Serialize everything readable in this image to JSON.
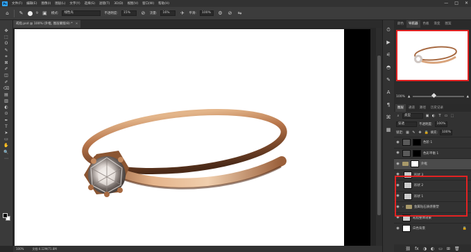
{
  "menubar": {
    "items": [
      "文件(F)",
      "编辑(E)",
      "图像(I)",
      "图层(L)",
      "文字(Y)",
      "选择(S)",
      "滤镜(T)",
      "3D(D)",
      "视图(V)",
      "窗口(W)",
      "帮助(H)"
    ],
    "window_controls": [
      "—",
      "□",
      "✕"
    ]
  },
  "optbar": {
    "brush_size": "9",
    "mode_label": "模式:",
    "mode_value": "线性光",
    "opacity_label": "不透明度:",
    "opacity_value": "15%",
    "flow_label": "流量:",
    "flow_value": "16%",
    "smooth_label": "平滑:",
    "smooth_value": "100%"
  },
  "tab": {
    "title": "戒指.psd @ 100% (外框, 图层蒙版/8) *",
    "close": "×"
  },
  "toolbar": {
    "tools": [
      "✥",
      "⬚",
      "ʘ",
      "✎",
      "⌗",
      "⊠",
      "✐",
      "◫",
      "✐",
      "⌫",
      "▤",
      "▥",
      "◐",
      "⊙",
      "✒",
      "T",
      "➤",
      "▭",
      "✋",
      "🔍",
      "⋯"
    ]
  },
  "statusbar": {
    "zoom": "100%",
    "doc": "文档:4.12M/71.8M"
  },
  "panels": {
    "tabs": [
      "颜色",
      "导航器",
      "色板",
      "渐变",
      "图案"
    ],
    "active_tab": "导航器",
    "zoom_value": "100%"
  },
  "layers_panel": {
    "tabs": [
      "图层",
      "通道",
      "路径",
      "历史记录"
    ],
    "filter_label": "类型",
    "blend_mode": "穿透",
    "opacity_label": "不透明度:",
    "opacity_value": "100%",
    "lock_label": "锁定:",
    "fill_label": "填充:",
    "fill_value": "100%",
    "layers": [
      {
        "name": "色阶 1"
      },
      {
        "name": "色彩平衡 1"
      },
      {
        "name": "外框"
      },
      {
        "name": "形状 3"
      },
      {
        "name": "形状 2"
      },
      {
        "name": "形状 1"
      },
      {
        "name": "金属钻石质感重塑"
      },
      {
        "name": "戒指整体效果"
      },
      {
        "name": "白色背景"
      }
    ],
    "footer_icons": [
      "⛓",
      "fx",
      "◑",
      "◐",
      "▭",
      "⊞",
      "🗑"
    ]
  }
}
